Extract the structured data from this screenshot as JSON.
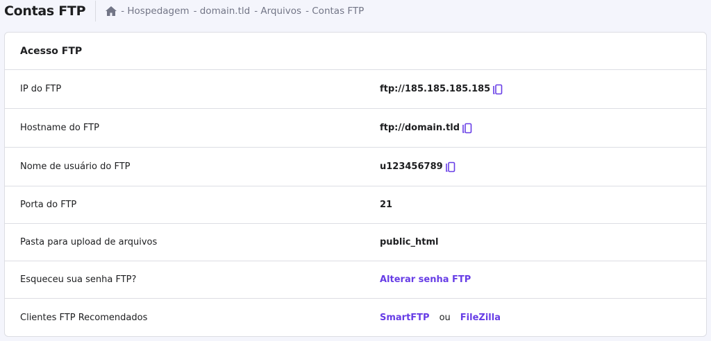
{
  "header": {
    "title": "Contas FTP",
    "breadcrumb": [
      "- Hospedagem",
      "- domain.tld",
      "- Arquivos",
      "- Contas FTP"
    ]
  },
  "card": {
    "title": "Acesso FTP",
    "rows": [
      {
        "label": "IP do FTP",
        "value": "ftp://185.185.185.185"
      },
      {
        "label": "Hostname do FTP",
        "value": "ftp://domain.tld"
      },
      {
        "label": "Nome de usuário do FTP",
        "value": "u123456789"
      },
      {
        "label": "Porta do FTP",
        "value": "21"
      },
      {
        "label": "Pasta para upload de arquivos",
        "value": "public_html"
      },
      {
        "label": "Esqueceu sua senha FTP?",
        "value": "Alterar senha FTP"
      },
      {
        "label": "Clientes FTP Recomendados",
        "value": "SmartFTP",
        "separator": "ou",
        "value2": "FileZilla"
      }
    ]
  },
  "colors": {
    "accent": "#673de6",
    "text": "#1d1e20"
  }
}
